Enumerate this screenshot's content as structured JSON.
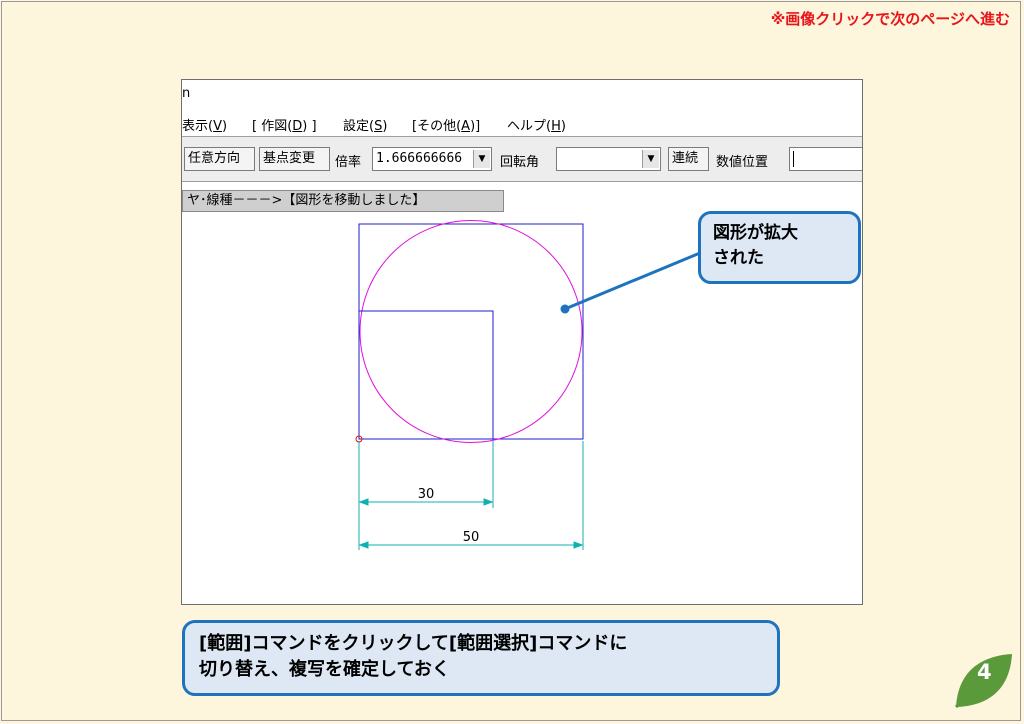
{
  "header": {
    "next_page_note": "※画像クリックで次のページへ進む"
  },
  "app": {
    "title_fragment": "n",
    "menu": [
      {
        "label": "表示(",
        "key": "V",
        "end": ")"
      },
      {
        "label": "[ 作図(",
        "key": "D",
        "end": ") ]"
      },
      {
        "label": "設定(",
        "key": "S",
        "end": ")"
      },
      {
        "label": "[その他(",
        "key": "A",
        "end": ")]"
      },
      {
        "label": "ヘルプ(",
        "key": "H",
        "end": ")"
      }
    ],
    "toolbar": {
      "any_direction": "任意方向",
      "base_change": "基点変更",
      "scale_label": "倍率",
      "scale_value": "1.666666666",
      "rotation_label": "回転角",
      "rotation_value": "",
      "continuous": "連続",
      "numeric_position": "数値位置",
      "numeric_value": ""
    },
    "status_message": "ヤ･線種－－－>【図形を移動しました】",
    "drawing": {
      "dim_small": "30",
      "dim_large": "50"
    }
  },
  "callout": {
    "line1": "図形が拡大",
    "line2": "された"
  },
  "instruction": {
    "line1": "[範囲]コマンドをクリックして[範囲選択]コマンドに",
    "line2": "切り替え、複写を確定しておく"
  },
  "page_number": "4",
  "colors": {
    "background": "#fdf5dc",
    "accent_red": "#e8141a",
    "callout_border": "#1e73be",
    "callout_fill": "#dde8f4",
    "shape_blue": "#1c1ccc",
    "circle_magenta": "#e010e0",
    "dimension_cyan": "#10b0b0",
    "leaf_green": "#5a9a3a"
  }
}
